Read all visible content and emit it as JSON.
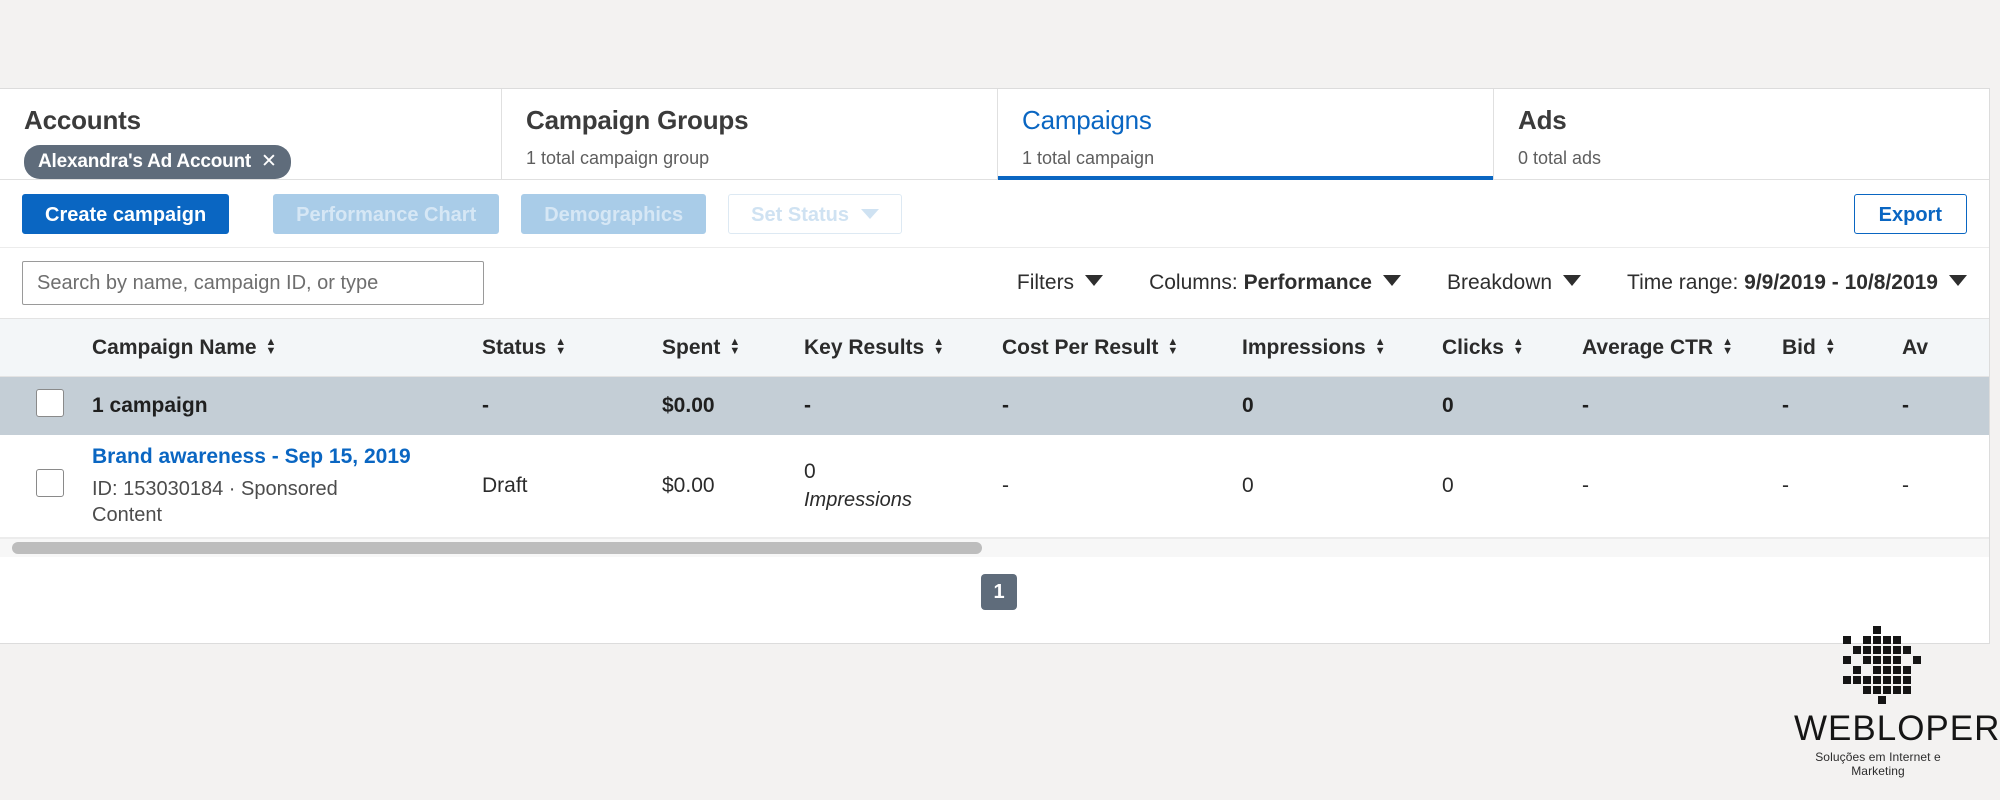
{
  "tabs": [
    {
      "title": "Accounts",
      "sub": "",
      "chip": "Alexandra's Ad Account",
      "chip_close": "✕",
      "active": false
    },
    {
      "title": "Campaign Groups",
      "sub": "1 total campaign group",
      "active": false
    },
    {
      "title": "Campaigns",
      "sub": "1 total campaign",
      "active": true
    },
    {
      "title": "Ads",
      "sub": "0 total ads",
      "active": false
    }
  ],
  "toolbar": {
    "create_label": "Create campaign",
    "performance_chart_label": "Performance Chart",
    "demographics_label": "Demographics",
    "set_status_label": "Set Status",
    "export_label": "Export"
  },
  "search": {
    "value": "",
    "placeholder": "Search by name, campaign ID, or type"
  },
  "filters": {
    "filters_label": "Filters",
    "columns_prefix": "Columns: ",
    "columns_value": "Performance",
    "breakdown_label": "Breakdown",
    "time_range_prefix": "Time range: ",
    "time_range_value": "9/9/2019 - 10/8/2019"
  },
  "table": {
    "columns": [
      "Campaign Name",
      "Status",
      "Spent",
      "Key Results",
      "Cost Per Result",
      "Impressions",
      "Clicks",
      "Average CTR",
      "Bid",
      "Av"
    ],
    "summary": {
      "label": "1 campaign",
      "status": "-",
      "spent": "$0.00",
      "key_results": "-",
      "cost_per_result": "-",
      "impressions": "0",
      "clicks": "0",
      "average_ctr": "-",
      "bid": "-",
      "last": "-"
    },
    "rows": [
      {
        "name": "Brand awareness - Sep 15, 2019",
        "meta": "ID: 153030184 · Sponsored Content",
        "status": "Draft",
        "spent": "$0.00",
        "key_results_value": "0",
        "key_results_unit": "Impressions",
        "cost_per_result": "-",
        "impressions": "0",
        "clicks": "0",
        "average_ctr": "-",
        "bid": "-",
        "last": "-"
      }
    ]
  },
  "pagination": {
    "current_page": "1"
  },
  "logo": {
    "wordmark": "WEBLOPER",
    "tagline": "Soluções em Internet e Marketing"
  },
  "colors": {
    "accent": "#0a66c2",
    "chip": "#5f6c7b",
    "summary_row": "#c4ced6",
    "header_row": "#f3f6f8"
  }
}
